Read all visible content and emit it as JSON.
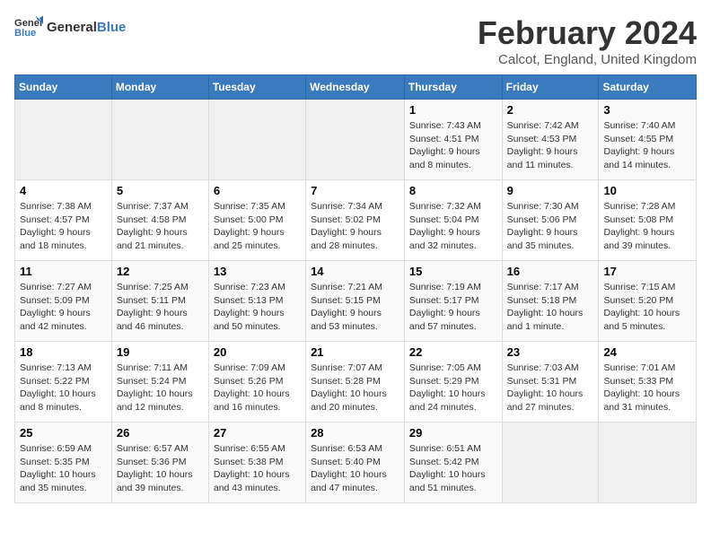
{
  "header": {
    "logo_general": "General",
    "logo_blue": "Blue",
    "month_title": "February 2024",
    "location": "Calcot, England, United Kingdom"
  },
  "days_of_week": [
    "Sunday",
    "Monday",
    "Tuesday",
    "Wednesday",
    "Thursday",
    "Friday",
    "Saturday"
  ],
  "weeks": [
    [
      {
        "day": "",
        "info": ""
      },
      {
        "day": "",
        "info": ""
      },
      {
        "day": "",
        "info": ""
      },
      {
        "day": "",
        "info": ""
      },
      {
        "day": "1",
        "info": "Sunrise: 7:43 AM\nSunset: 4:51 PM\nDaylight: 9 hours\nand 8 minutes."
      },
      {
        "day": "2",
        "info": "Sunrise: 7:42 AM\nSunset: 4:53 PM\nDaylight: 9 hours\nand 11 minutes."
      },
      {
        "day": "3",
        "info": "Sunrise: 7:40 AM\nSunset: 4:55 PM\nDaylight: 9 hours\nand 14 minutes."
      }
    ],
    [
      {
        "day": "4",
        "info": "Sunrise: 7:38 AM\nSunset: 4:57 PM\nDaylight: 9 hours\nand 18 minutes."
      },
      {
        "day": "5",
        "info": "Sunrise: 7:37 AM\nSunset: 4:58 PM\nDaylight: 9 hours\nand 21 minutes."
      },
      {
        "day": "6",
        "info": "Sunrise: 7:35 AM\nSunset: 5:00 PM\nDaylight: 9 hours\nand 25 minutes."
      },
      {
        "day": "7",
        "info": "Sunrise: 7:34 AM\nSunset: 5:02 PM\nDaylight: 9 hours\nand 28 minutes."
      },
      {
        "day": "8",
        "info": "Sunrise: 7:32 AM\nSunset: 5:04 PM\nDaylight: 9 hours\nand 32 minutes."
      },
      {
        "day": "9",
        "info": "Sunrise: 7:30 AM\nSunset: 5:06 PM\nDaylight: 9 hours\nand 35 minutes."
      },
      {
        "day": "10",
        "info": "Sunrise: 7:28 AM\nSunset: 5:08 PM\nDaylight: 9 hours\nand 39 minutes."
      }
    ],
    [
      {
        "day": "11",
        "info": "Sunrise: 7:27 AM\nSunset: 5:09 PM\nDaylight: 9 hours\nand 42 minutes."
      },
      {
        "day": "12",
        "info": "Sunrise: 7:25 AM\nSunset: 5:11 PM\nDaylight: 9 hours\nand 46 minutes."
      },
      {
        "day": "13",
        "info": "Sunrise: 7:23 AM\nSunset: 5:13 PM\nDaylight: 9 hours\nand 50 minutes."
      },
      {
        "day": "14",
        "info": "Sunrise: 7:21 AM\nSunset: 5:15 PM\nDaylight: 9 hours\nand 53 minutes."
      },
      {
        "day": "15",
        "info": "Sunrise: 7:19 AM\nSunset: 5:17 PM\nDaylight: 9 hours\nand 57 minutes."
      },
      {
        "day": "16",
        "info": "Sunrise: 7:17 AM\nSunset: 5:18 PM\nDaylight: 10 hours\nand 1 minute."
      },
      {
        "day": "17",
        "info": "Sunrise: 7:15 AM\nSunset: 5:20 PM\nDaylight: 10 hours\nand 5 minutes."
      }
    ],
    [
      {
        "day": "18",
        "info": "Sunrise: 7:13 AM\nSunset: 5:22 PM\nDaylight: 10 hours\nand 8 minutes."
      },
      {
        "day": "19",
        "info": "Sunrise: 7:11 AM\nSunset: 5:24 PM\nDaylight: 10 hours\nand 12 minutes."
      },
      {
        "day": "20",
        "info": "Sunrise: 7:09 AM\nSunset: 5:26 PM\nDaylight: 10 hours\nand 16 minutes."
      },
      {
        "day": "21",
        "info": "Sunrise: 7:07 AM\nSunset: 5:28 PM\nDaylight: 10 hours\nand 20 minutes."
      },
      {
        "day": "22",
        "info": "Sunrise: 7:05 AM\nSunset: 5:29 PM\nDaylight: 10 hours\nand 24 minutes."
      },
      {
        "day": "23",
        "info": "Sunrise: 7:03 AM\nSunset: 5:31 PM\nDaylight: 10 hours\nand 27 minutes."
      },
      {
        "day": "24",
        "info": "Sunrise: 7:01 AM\nSunset: 5:33 PM\nDaylight: 10 hours\nand 31 minutes."
      }
    ],
    [
      {
        "day": "25",
        "info": "Sunrise: 6:59 AM\nSunset: 5:35 PM\nDaylight: 10 hours\nand 35 minutes."
      },
      {
        "day": "26",
        "info": "Sunrise: 6:57 AM\nSunset: 5:36 PM\nDaylight: 10 hours\nand 39 minutes."
      },
      {
        "day": "27",
        "info": "Sunrise: 6:55 AM\nSunset: 5:38 PM\nDaylight: 10 hours\nand 43 minutes."
      },
      {
        "day": "28",
        "info": "Sunrise: 6:53 AM\nSunset: 5:40 PM\nDaylight: 10 hours\nand 47 minutes."
      },
      {
        "day": "29",
        "info": "Sunrise: 6:51 AM\nSunset: 5:42 PM\nDaylight: 10 hours\nand 51 minutes."
      },
      {
        "day": "",
        "info": ""
      },
      {
        "day": "",
        "info": ""
      }
    ]
  ]
}
